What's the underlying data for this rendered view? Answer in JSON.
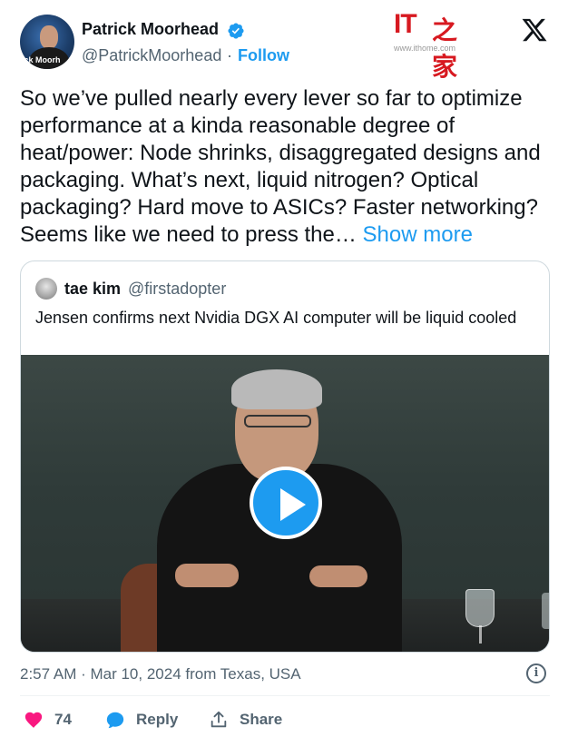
{
  "author": {
    "name": "Patrick Moorhead",
    "handle": "@PatrickMoorhead",
    "separator": "·",
    "follow_label": "Follow",
    "avatar_text": "ick Moorh",
    "verified_color": "#1d9bf0"
  },
  "watermark": {
    "logo_text": "IT",
    "logo_zh": "之家",
    "url": "www.ithome.com"
  },
  "tweet": {
    "text": "So we’ve pulled nearly every lever so far to optimize performance at a kinda reasonable degree of heat/power: Node shrinks, disaggregated designs and packaging. What’s next, liquid nitrogen? Optical packaging? Hard move to ASICs? Faster networking? Seems like we need to press the…",
    "show_more": "Show more"
  },
  "quote": {
    "name": "tae kim",
    "handle": "@firstadopter",
    "text": "Jensen confirms next Nvidia DGX AI computer will be liquid cooled",
    "media_type": "video",
    "play_icon": "play-icon"
  },
  "meta": {
    "timestamp": "2:57 AM · Mar 10, 2024 from Texas, USA",
    "info_icon": "i"
  },
  "actions": {
    "like_count": "74",
    "reply_label": "Reply",
    "share_label": "Share"
  },
  "colors": {
    "accent": "#1d9bf0",
    "like": "#f91880",
    "text": "#0f1419",
    "muted": "#536471",
    "watermark_red": "#d71920"
  }
}
